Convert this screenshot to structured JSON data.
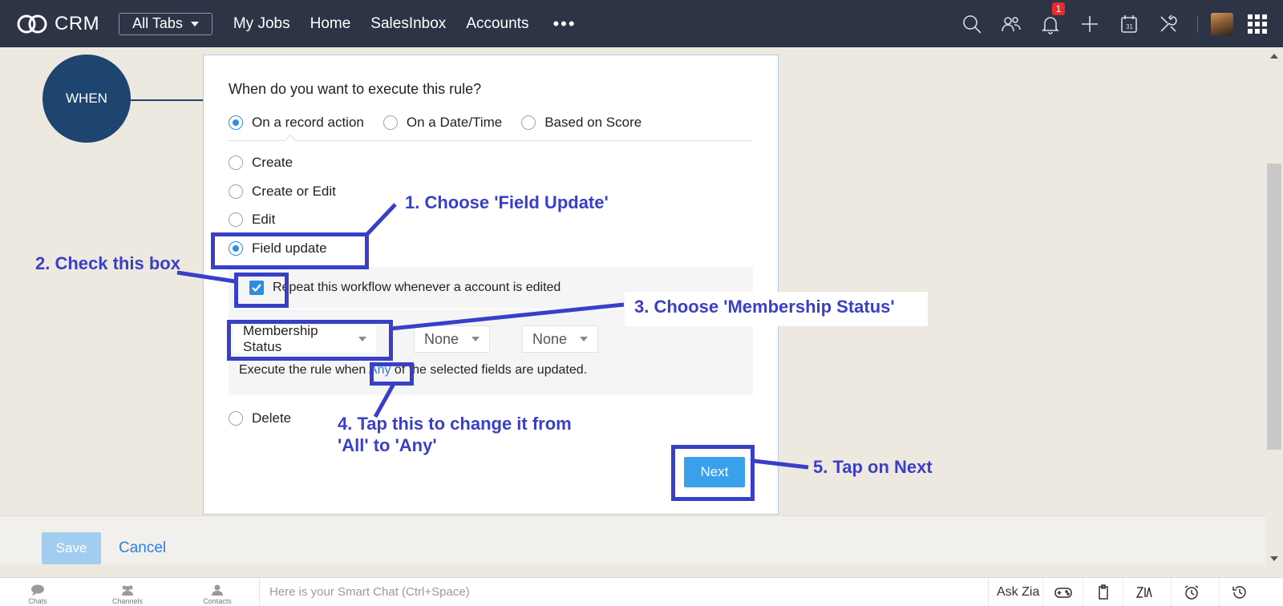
{
  "topbar": {
    "logo_text": "CRM",
    "all_tabs_label": "All Tabs",
    "nav": [
      "My Jobs",
      "Home",
      "SalesInbox",
      "Accounts"
    ],
    "more_label": "•••",
    "notification_count": "1",
    "icons": [
      "search-icon",
      "contacts-icon",
      "bell-icon",
      "plus-icon",
      "calendar-icon",
      "tools-icon",
      "avatar",
      "apps-grid-icon"
    ]
  },
  "flow": {
    "node_label": "WHEN"
  },
  "form": {
    "question": "When do you want to execute this rule?",
    "execute_options": [
      {
        "label": "On a record action",
        "selected": true
      },
      {
        "label": "On a Date/Time",
        "selected": false
      },
      {
        "label": "Based on Score",
        "selected": false
      }
    ],
    "actions": [
      {
        "label": "Create",
        "selected": false
      },
      {
        "label": "Create or Edit",
        "selected": false
      },
      {
        "label": "Edit",
        "selected": false
      },
      {
        "label": "Field update",
        "selected": true
      },
      {
        "label": "Delete",
        "selected": false
      }
    ],
    "repeat_label": "Repeat this workflow whenever a account is edited",
    "repeat_checked": true,
    "field_selects": [
      "Membership Status",
      "None",
      "None"
    ],
    "rule_text_before": "Execute the rule when ",
    "rule_any": "Any",
    "rule_text_after": " of the selected fields are updated.",
    "next_label": "Next"
  },
  "footer": {
    "save_label": "Save",
    "cancel_label": "Cancel"
  },
  "chatbar": {
    "items": [
      "Chats",
      "Channels",
      "Contacts"
    ],
    "placeholder": "Here is your Smart Chat (Ctrl+Space)",
    "ask_zia": "Ask Zia",
    "icons": [
      "gamepad-icon",
      "clipboard-icon",
      "zia-icon",
      "alarm-icon",
      "history-icon"
    ]
  },
  "annotations": {
    "step1": "1. Choose 'Field Update'",
    "step2": "2. Check this box",
    "step3": "3. Choose 'Membership Status'",
    "step4_line1": "4. Tap this to change it from",
    "step4_line2": "'All' to 'Any'",
    "step5": "5. Tap on Next"
  },
  "colors": {
    "topbar": "#2c3445",
    "accent": "#2e8de0",
    "annotation": "#3a3fc7",
    "when_node": "#1e4470"
  }
}
